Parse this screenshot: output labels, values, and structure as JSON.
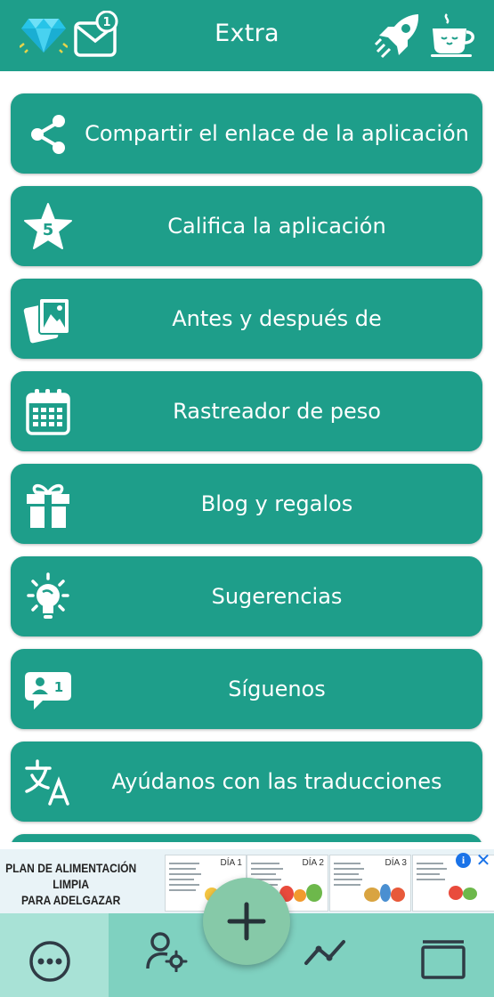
{
  "header": {
    "title": "Extra",
    "mail_badge": "1",
    "icons": [
      "diamond-icon",
      "mail-notification-icon",
      "rocket-icon",
      "coffee-cup-icon"
    ]
  },
  "menu": {
    "items": [
      {
        "label": "Compartir el enlace de la aplicación",
        "icon": "share-icon"
      },
      {
        "label": "Califica la aplicación",
        "icon": "star-rating-icon",
        "badge": "5"
      },
      {
        "label": "Antes y después de",
        "icon": "photos-icon"
      },
      {
        "label": "Rastreador de peso",
        "icon": "calendar-icon"
      },
      {
        "label": "Blog y regalos",
        "icon": "gift-icon"
      },
      {
        "label": "Sugerencias",
        "icon": "lightbulb-icon"
      },
      {
        "label": "Síguenos",
        "icon": "follow-chat-icon",
        "badge": "1"
      },
      {
        "label": "Ayúdanos con las traducciones",
        "icon": "translate-icon"
      }
    ]
  },
  "ad": {
    "headline_line1": "PLAN DE ALIMENTACIÓN LIMPIA",
    "headline_line2": "PARA ADELGAZAR",
    "cards": [
      "DÍA 1",
      "DÍA 2",
      "DÍA 3"
    ],
    "info_glyph": "i",
    "close_glyph": "✕"
  },
  "bottom_nav": {
    "items": [
      "more-icon",
      "profile-settings-icon",
      "add-icon",
      "progress-chart-icon",
      "window-icon"
    ],
    "active": "more-icon"
  },
  "colors": {
    "primary": "#1e9e8a",
    "nav_background": "#7fd1c0",
    "nav_active": "#a8e2d6",
    "fab": "#86c9a8"
  }
}
